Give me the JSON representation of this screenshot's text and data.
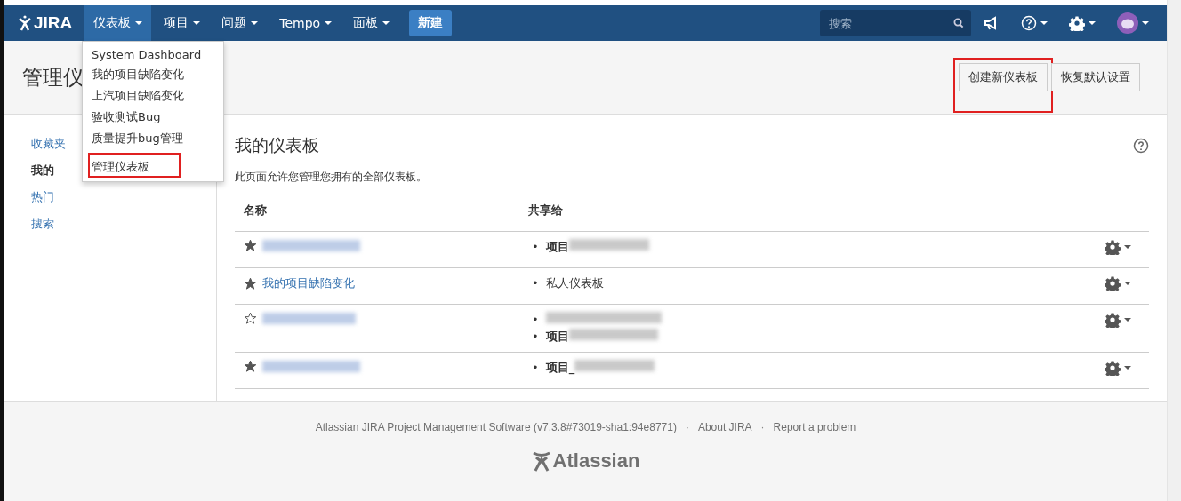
{
  "nav": {
    "logo": "JIRA",
    "menus": [
      {
        "label": "仪表板",
        "selected": true
      },
      {
        "label": "项目",
        "selected": false
      },
      {
        "label": "问题",
        "selected": false
      },
      {
        "label": "Tempo",
        "selected": false
      },
      {
        "label": "面板",
        "selected": false
      }
    ],
    "create": "新建",
    "search": {
      "placeholder": "搜索"
    }
  },
  "dropdown": {
    "items": [
      {
        "label": "System Dashboard",
        "highlighted": false
      },
      {
        "label": "我的项目缺陷变化",
        "highlighted": false
      },
      {
        "label": "上汽项目缺陷变化",
        "highlighted": false
      },
      {
        "label": "验收测试Bug",
        "highlighted": false
      },
      {
        "label": "质量提升bug管理",
        "highlighted": false
      },
      {
        "label": "管理仪表板",
        "highlighted": true
      }
    ]
  },
  "header": {
    "title": "管理仪",
    "buttons": [
      {
        "label": "创建新仪表板",
        "highlighted": true
      },
      {
        "label": "恢复默认设置",
        "highlighted": false
      }
    ]
  },
  "sidebar": {
    "items": [
      {
        "label": "收藏夹",
        "selected": false
      },
      {
        "label": "我的",
        "selected": true
      },
      {
        "label": "热门",
        "selected": false
      },
      {
        "label": "搜索",
        "selected": false
      }
    ]
  },
  "main": {
    "bullet": "•",
    "title": "我的仪表板",
    "description": "此页面允许您管理您拥有的全部仪表板。",
    "columns": [
      "名称",
      "共享给"
    ],
    "rows": [
      {
        "starred": true,
        "name_blurred": true,
        "shares": [
          {
            "text": "项目",
            "blurred": true
          }
        ]
      },
      {
        "starred": true,
        "name": "我的项目缺陷变化",
        "shares": [
          {
            "text": "私人仪表板",
            "blurred": false
          }
        ]
      },
      {
        "starred": false,
        "name_blurred": true,
        "shares": [
          {
            "blurred": true
          },
          {
            "text": "项目",
            "blurred": true
          }
        ]
      },
      {
        "starred": true,
        "name_blurred": true,
        "shares": [
          {
            "text": "项目_",
            "blurred": true
          }
        ]
      }
    ]
  },
  "footer": {
    "version": "Atlassian JIRA Project Management Software (v7.3.8#73019-sha1:94e8771)",
    "separator": "·",
    "links": [
      "About JIRA",
      "Report a problem"
    ],
    "logo": "Atlassian"
  }
}
